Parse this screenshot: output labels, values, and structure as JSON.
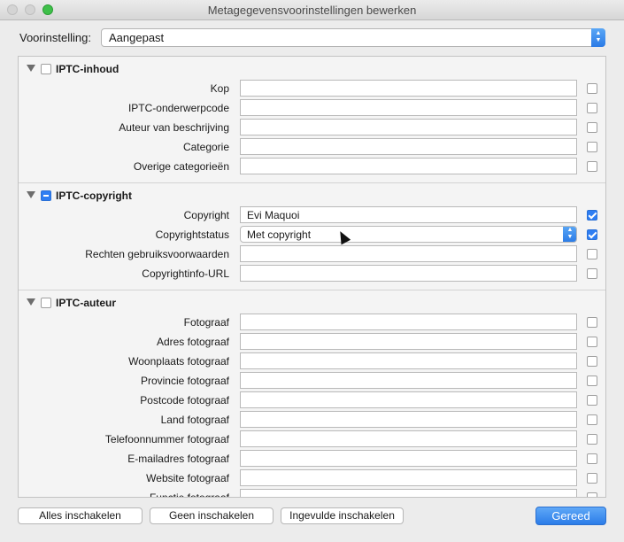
{
  "window": {
    "title": "Metagegevensvoorinstellingen bewerken"
  },
  "preset": {
    "label": "Voorinstelling:",
    "value": "Aangepast"
  },
  "sections": [
    {
      "title": "IPTC-inhoud",
      "state": "unchecked",
      "fields": [
        {
          "label": "Kop",
          "value": "",
          "checked": false
        },
        {
          "label": "IPTC-onderwerpcode",
          "value": "",
          "checked": false
        },
        {
          "label": "Auteur van beschrijving",
          "value": "",
          "checked": false
        },
        {
          "label": "Categorie",
          "value": "",
          "checked": false
        },
        {
          "label": "Overige categorieën",
          "value": "",
          "checked": false
        }
      ]
    },
    {
      "title": "IPTC-copyright",
      "state": "mixed",
      "fields": [
        {
          "label": "Copyright",
          "value": "Evi Maquoi",
          "checked": true
        },
        {
          "label": "Copyrightstatus",
          "value": "Met copyright",
          "checked": true,
          "type": "select"
        },
        {
          "label": "Rechten gebruiksvoorwaarden",
          "value": "",
          "checked": false
        },
        {
          "label": "Copyrightinfo-URL",
          "value": "",
          "checked": false
        }
      ]
    },
    {
      "title": "IPTC-auteur",
      "state": "unchecked",
      "fields": [
        {
          "label": "Fotograaf",
          "value": "",
          "checked": false
        },
        {
          "label": "Adres fotograaf",
          "value": "",
          "checked": false
        },
        {
          "label": "Woonplaats fotograaf",
          "value": "",
          "checked": false
        },
        {
          "label": "Provincie fotograaf",
          "value": "",
          "checked": false
        },
        {
          "label": "Postcode fotograaf",
          "value": "",
          "checked": false
        },
        {
          "label": "Land fotograaf",
          "value": "",
          "checked": false
        },
        {
          "label": "Telefoonnummer fotograaf",
          "value": "",
          "checked": false
        },
        {
          "label": "E-mailadres fotograaf",
          "value": "",
          "checked": false
        },
        {
          "label": "Website fotograaf",
          "value": "",
          "checked": false
        },
        {
          "label": "Functie fotograaf",
          "value": "",
          "checked": false
        }
      ]
    }
  ],
  "footer": {
    "check_all": "Alles inschakelen",
    "check_none": "Geen inschakelen",
    "check_filled": "Ingevulde inschakelen",
    "done": "Gereed"
  },
  "colors": {
    "accent": "#2e7ef3",
    "window_bg": "#ececec"
  }
}
